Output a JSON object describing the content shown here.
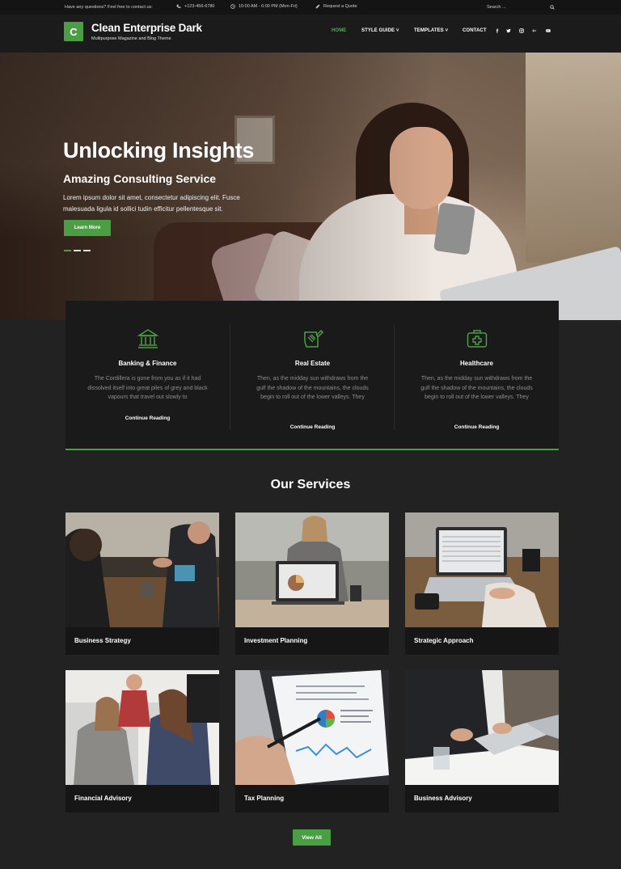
{
  "topbar": {
    "message": "Have any questions? Feel free to contact us:",
    "phone": "+123-456-6780",
    "hours": "10:00 AM - 6:00 PM (Mon-Fri)",
    "quote": "Request a Quote",
    "search_placeholder": "Search ..."
  },
  "header": {
    "logo_letter": "C",
    "site_title": "Clean Enterprise Dark",
    "tagline": "Multipurpose Magazine and Blog Theme",
    "nav": {
      "home": "HOME",
      "style_guide": "STYLE GUIDE",
      "templates": "TEMPLATES",
      "contact": "CONTACT"
    },
    "social_icons": [
      "facebook-icon",
      "twitter-icon",
      "instagram-icon",
      "google-plus-icon",
      "youtube-icon"
    ]
  },
  "hero": {
    "title": "Unlocking Insights",
    "subtitle": "Amazing Consulting Service",
    "text": "Lorem ipsum dolor sit amet, consectetur adipiscing elit. Fusce malesuada ligula id sollici tudin efficitur pellentesque sit.",
    "button": "Learn More"
  },
  "features": [
    {
      "icon": "bank-icon",
      "title": "Banking & Finance",
      "text": "The Cordillera is gone from you as if it had dissolved itself into great piles of grey and black vapours that travel out slowly to",
      "link": "Continue Reading"
    },
    {
      "icon": "real-estate-icon",
      "title": "Real Estate",
      "text": "Then, as the midday sun withdraws from the gulf the shadow of the mountains, the clouds begin to roll out of the lower valleys. They",
      "link": "Continue Reading"
    },
    {
      "icon": "medical-kit-icon",
      "title": "Healthcare",
      "text": "Then, as the midday sun withdraws from the gulf the shadow of the mountains, the clouds begin to roll out of the lower valleys. They",
      "link": "Continue Reading"
    }
  ],
  "services": {
    "title": "Our Services",
    "items": [
      {
        "label": "Business Strategy"
      },
      {
        "label": "Investment Planning"
      },
      {
        "label": "Strategic Approach"
      },
      {
        "label": "Financial Advisory"
      },
      {
        "label": "Tax Planning"
      },
      {
        "label": "Business Advisory"
      }
    ],
    "view_all": "View All"
  },
  "colors": {
    "accent": "#4c9e45",
    "background": "#222222",
    "panel": "#1a1a1a"
  }
}
